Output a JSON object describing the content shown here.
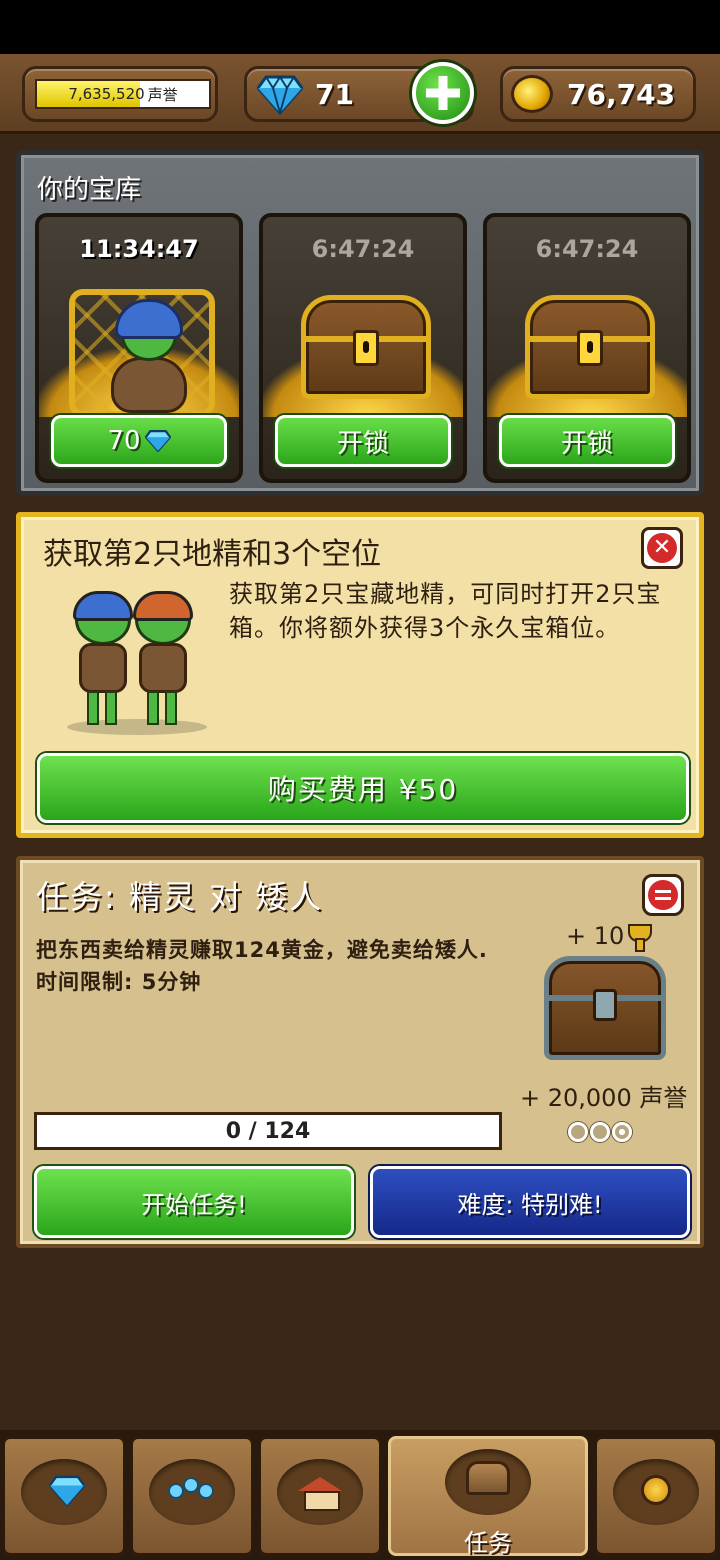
{
  "topbar": {
    "reputation_value": "7,635,520",
    "reputation_unit": "声誉",
    "reputation_progress": 0.6,
    "gems": "71",
    "gold": "76,743"
  },
  "vault": {
    "title": "你的宝库",
    "slots": [
      {
        "timer": "11:34:47",
        "button": "70",
        "button_icon": "diamond-icon",
        "content": "goblin-in-cage"
      },
      {
        "timer": "6:47:24",
        "button": "开锁",
        "content": "treasure-chest"
      },
      {
        "timer": "6:47:24",
        "button": "开锁",
        "content": "treasure-chest"
      }
    ]
  },
  "offer": {
    "title": "获取第2只地精和3个空位",
    "description": "获取第2只宝藏地精，可同时打开2只宝箱。你将额外获得3个永久宝箱位。",
    "buy_label": "购买费用 ¥50",
    "close_icon": "close-icon"
  },
  "quest": {
    "title": "任务: 精灵 对 矮人",
    "description": "把东西卖给精灵赚取124黄金，避免卖给矮人. 时间限制: 5分钟",
    "reward_trophy": "+ 10",
    "reward_reputation": "+ 20,000 声誉",
    "progress_text": "0 / 124",
    "progress_value": 0,
    "progress_max": 124,
    "difficulty_filled": 1,
    "difficulty_total": 3,
    "start_label": "开始任务!",
    "difficulty_label": "难度: 特别难!"
  },
  "nav": {
    "items": [
      {
        "icon": "diamond-icon",
        "label": ""
      },
      {
        "icon": "users-icon",
        "label": ""
      },
      {
        "icon": "house-icon",
        "label": ""
      },
      {
        "icon": "chest-icon",
        "label": "任务",
        "active": true
      },
      {
        "icon": "medal-icon",
        "label": ""
      }
    ]
  },
  "colors": {
    "green_button": "#3fbf2b",
    "blue_button": "#1c35a6",
    "gold_border": "#e5b520",
    "wood": "#6b4826"
  }
}
